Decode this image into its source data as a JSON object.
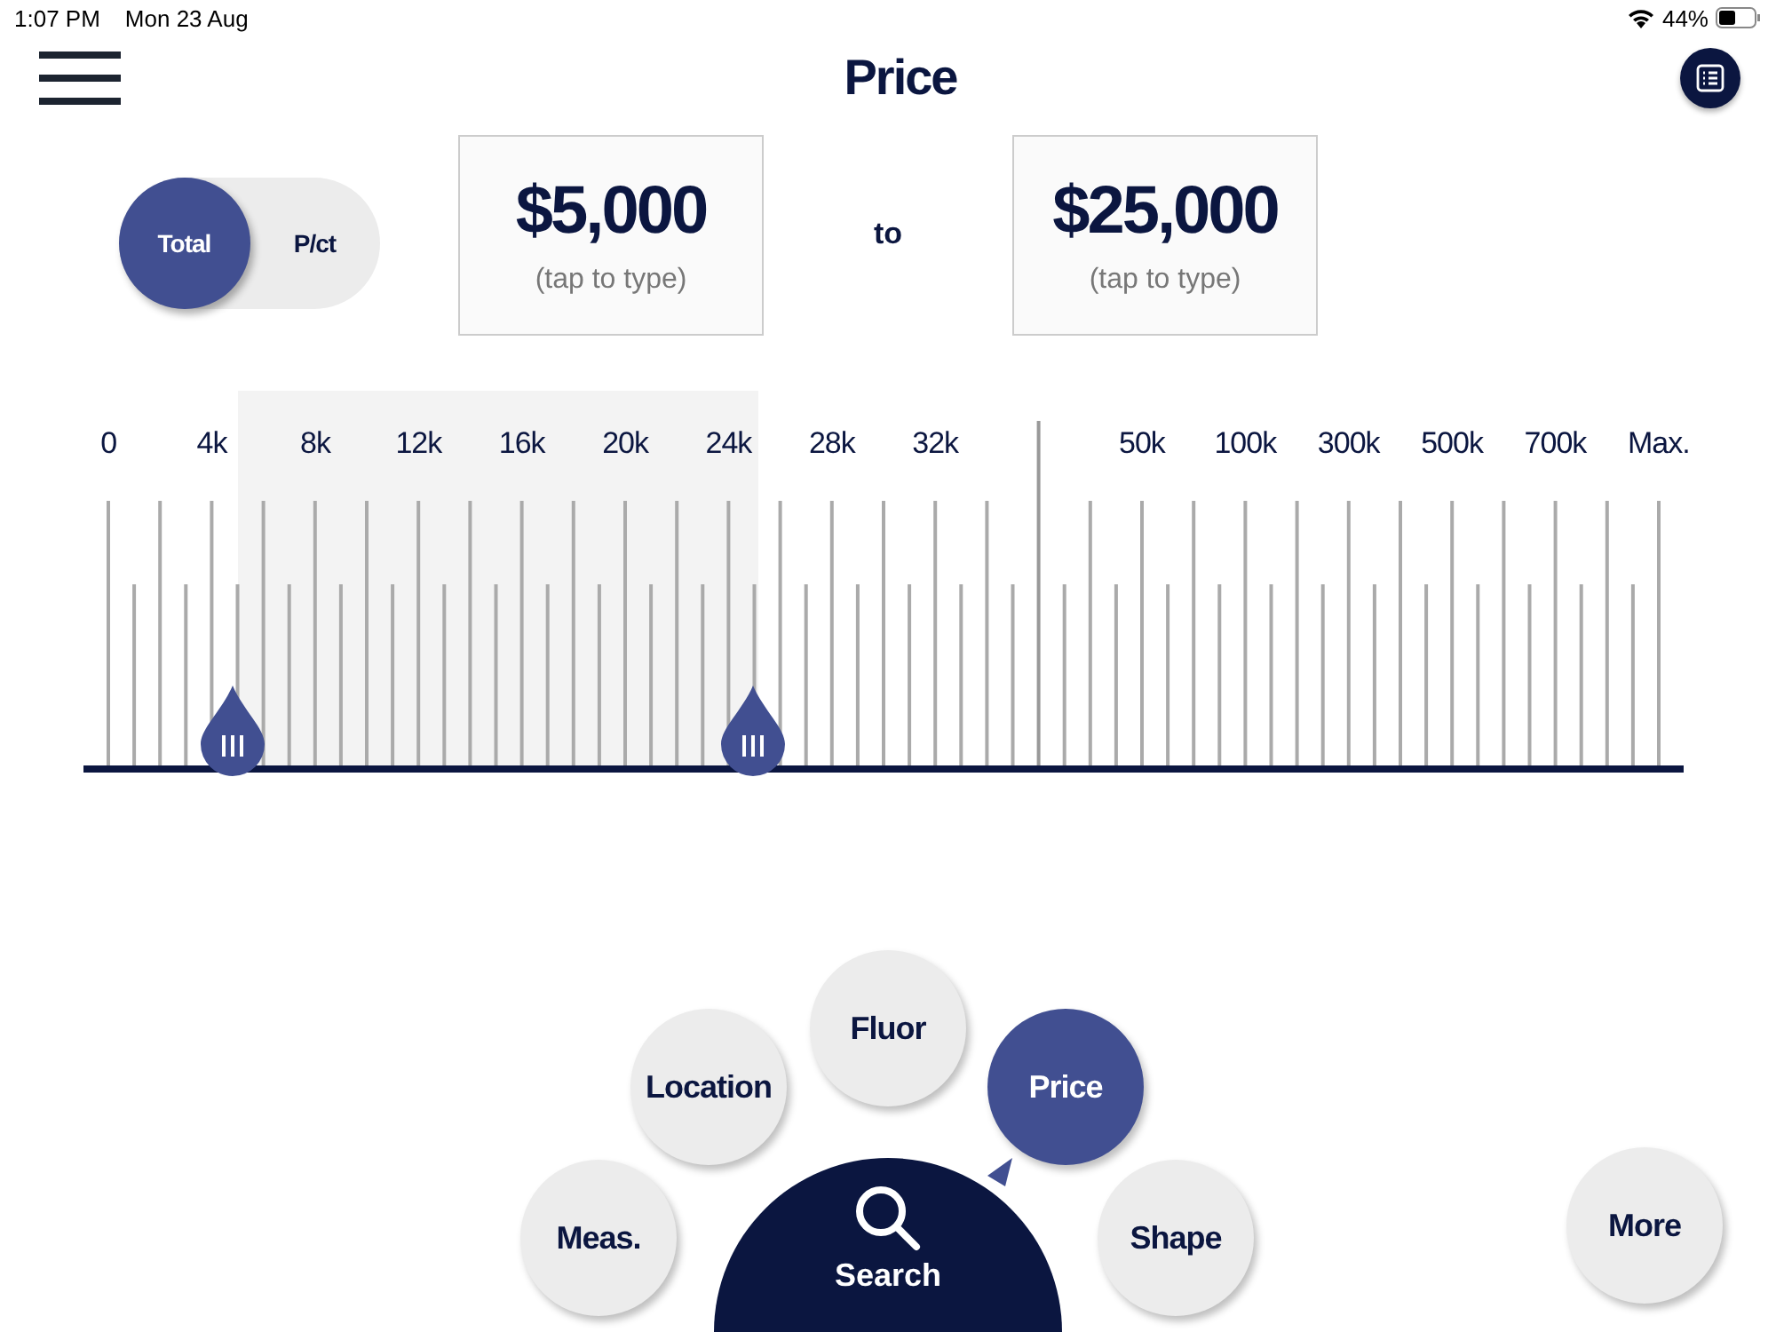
{
  "status_bar": {
    "time": "1:07 PM",
    "date": "Mon 23 Aug",
    "battery": "44%"
  },
  "header": {
    "title": "Price"
  },
  "mode_toggle": [
    {
      "label": "Total",
      "selected": true
    },
    {
      "label": "P/ct",
      "selected": false
    }
  ],
  "range": {
    "from": {
      "value": "$5,000",
      "hint": "(tap to type)"
    },
    "separator": "to",
    "to": {
      "value": "$25,000",
      "hint": "(tap to type)"
    }
  },
  "scale": [
    {
      "kind": "label",
      "label": "0"
    },
    {
      "kind": "label",
      "label": "4k"
    },
    {
      "kind": "label",
      "label": "8k"
    },
    {
      "kind": "label",
      "label": "12k"
    },
    {
      "kind": "label",
      "label": "16k"
    },
    {
      "kind": "label",
      "label": "20k"
    },
    {
      "kind": "label",
      "label": "24k"
    },
    {
      "kind": "label",
      "label": "28k"
    },
    {
      "kind": "label",
      "label": "32k"
    },
    {
      "kind": "divider"
    },
    {
      "kind": "label",
      "label": "50k"
    },
    {
      "kind": "label",
      "label": "100k"
    },
    {
      "kind": "label",
      "label": "300k"
    },
    {
      "kind": "label",
      "label": "500k"
    },
    {
      "kind": "label",
      "label": "700k"
    },
    {
      "kind": "label",
      "label": "Max."
    }
  ],
  "thumbs": [
    {
      "level": 0.093
    },
    {
      "level": 0.418
    }
  ],
  "filters": [
    {
      "label": "Meas.",
      "selected": false
    },
    {
      "label": "Location",
      "selected": false
    },
    {
      "label": "Fluor",
      "selected": false
    },
    {
      "label": "Price",
      "selected": true
    },
    {
      "label": "Shape",
      "selected": false
    }
  ],
  "search_button": {
    "label": "Search"
  },
  "more_button": {
    "label": "More"
  }
}
